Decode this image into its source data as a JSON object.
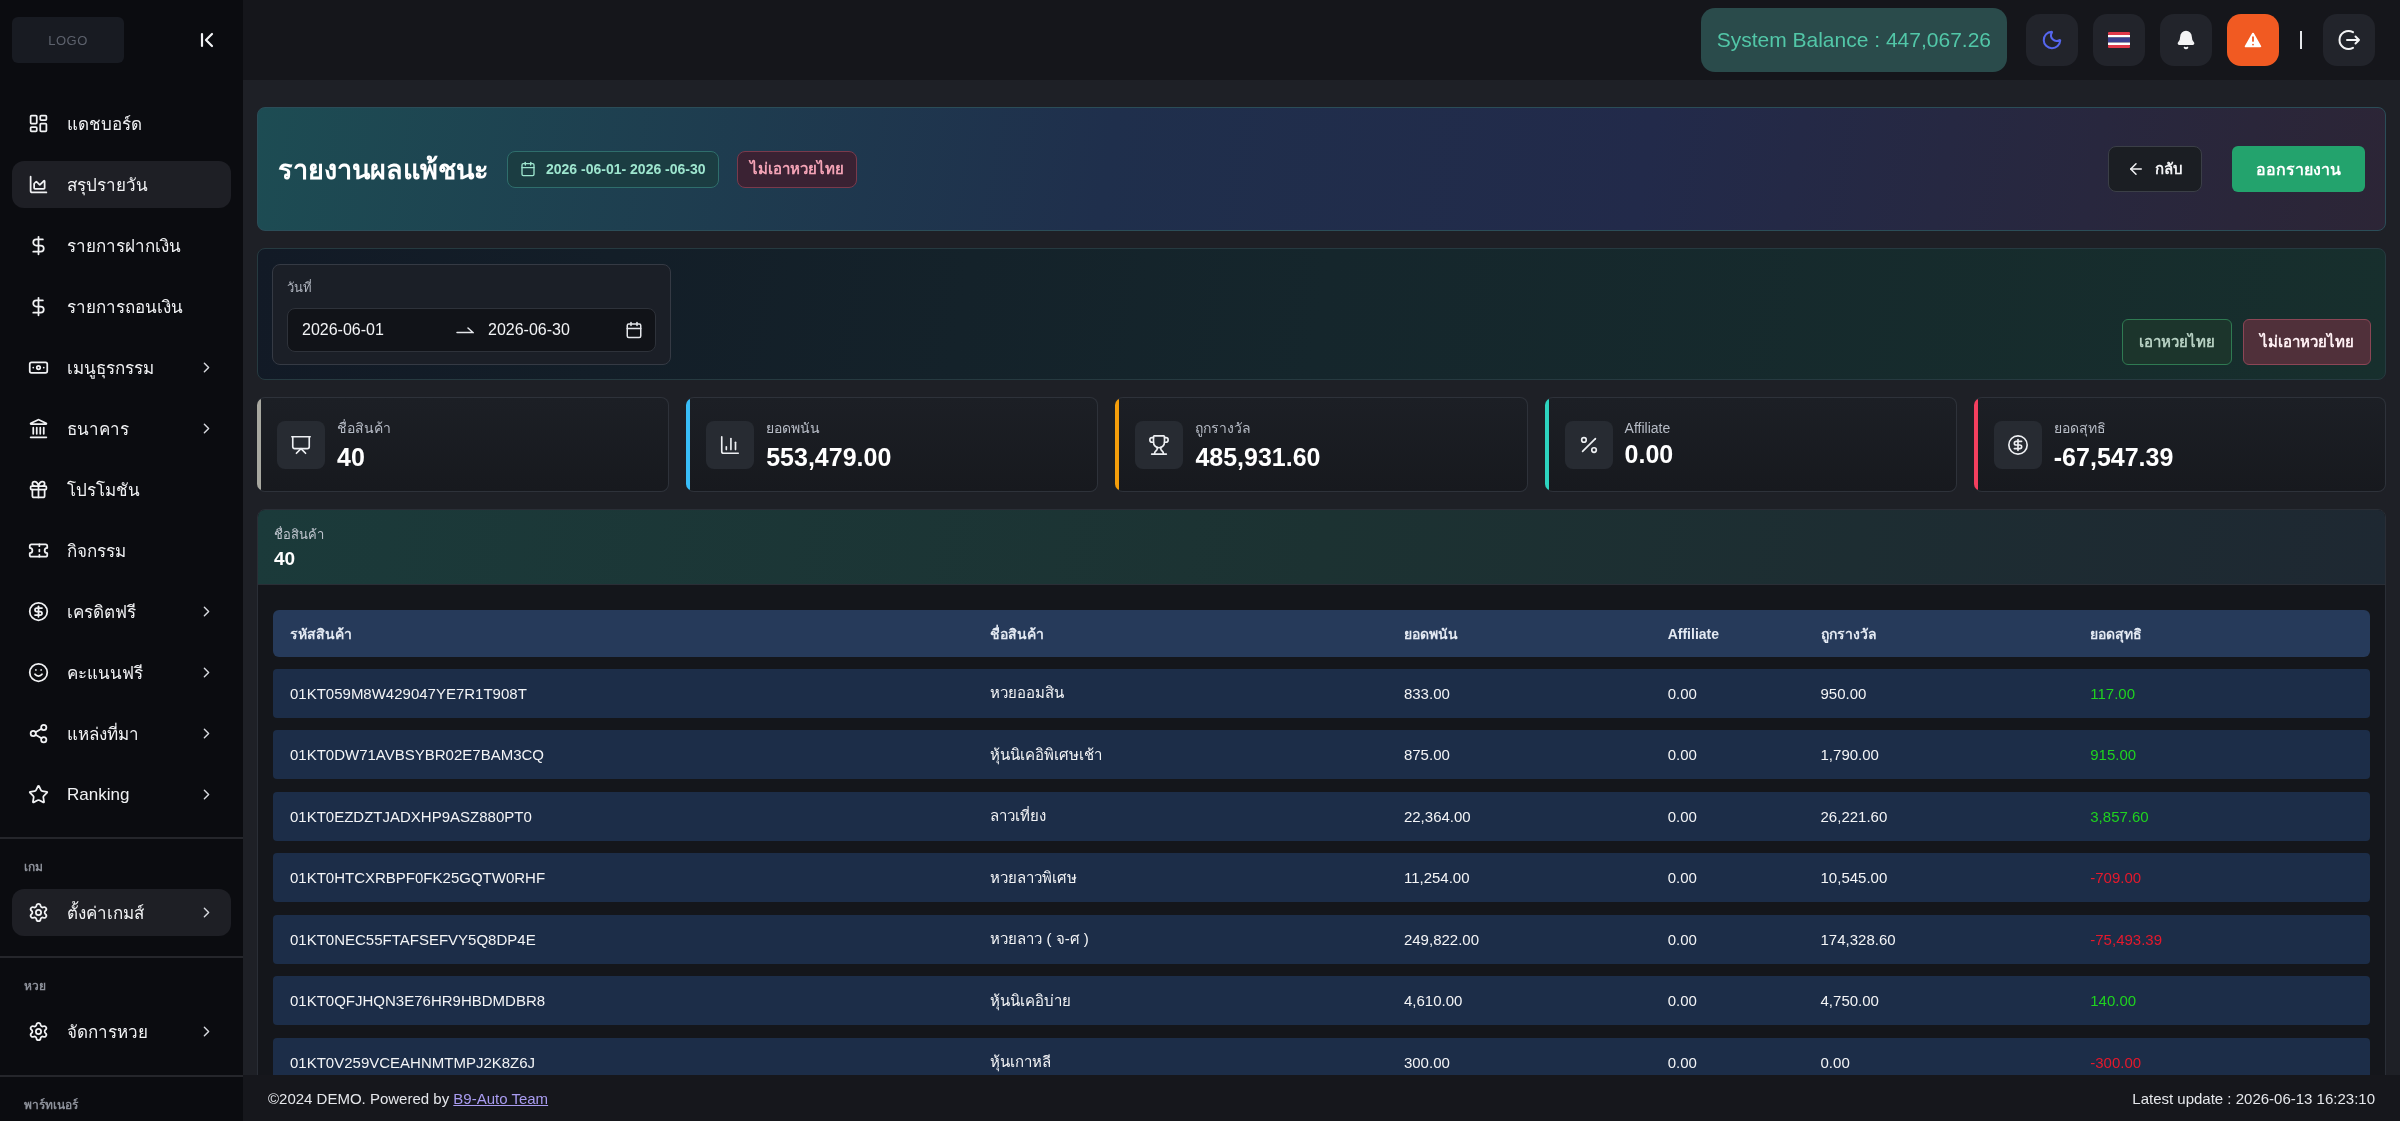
{
  "sidebar": {
    "logo": "LOGO",
    "items": [
      {
        "label": "แดชบอร์ด",
        "selected": false,
        "submenu": false
      },
      {
        "label": "สรุปรายวัน",
        "selected": true,
        "submenu": false
      },
      {
        "label": "รายการฝากเงิน",
        "selected": false,
        "submenu": false
      },
      {
        "label": "รายการถอนเงิน",
        "selected": false,
        "submenu": false
      },
      {
        "label": "เมนูธุรกรรม",
        "selected": false,
        "submenu": true
      },
      {
        "label": "ธนาคาร",
        "selected": false,
        "submenu": true
      },
      {
        "label": "โปรโมชัน",
        "selected": false,
        "submenu": false
      },
      {
        "label": "กิจกรรม",
        "selected": false,
        "submenu": false
      },
      {
        "label": "เครดิตฟรี",
        "selected": false,
        "submenu": true
      },
      {
        "label": "คะแนนฟรี",
        "selected": false,
        "submenu": true
      },
      {
        "label": "แหล่งที่มา",
        "selected": false,
        "submenu": true
      },
      {
        "label": "Ranking",
        "selected": false,
        "submenu": true
      }
    ],
    "sections": [
      {
        "title": "เกม",
        "items": [
          {
            "label": "ตั้งค่าเกมส์",
            "selected": true,
            "submenu": true
          }
        ]
      },
      {
        "title": "หวย",
        "items": [
          {
            "label": "จัดการหวย",
            "selected": false,
            "submenu": true
          }
        ]
      },
      {
        "title": "พาร์ทเนอร์"
      }
    ]
  },
  "topbar": {
    "balance": "System Balance : 447,067.26"
  },
  "header": {
    "title": "รายงานผลแพ้ชนะ",
    "date_tag": "2026 -06-01- 2026 -06-30",
    "filter_tag": "ไม่เอาหวยไทย",
    "back_button": "กลับ",
    "export_button": "ออกรายงาน"
  },
  "filter": {
    "date_label": "วันที่",
    "start_date": "2026-06-01",
    "end_date": "2026-06-30",
    "toggles": [
      {
        "label": "เอาหวยไทย",
        "selected": false,
        "color": "#2f7a52"
      },
      {
        "label": "ไม่เอาหวยไทย",
        "selected": true,
        "color": "#8c4656"
      }
    ]
  },
  "stats": [
    {
      "label": "ชื่อสินค้า",
      "value": "40",
      "color": "#a8a8a0"
    },
    {
      "label": "ยอดพนัน",
      "value": "553,479.00",
      "color": "#38bdf8"
    },
    {
      "label": "ถูกรางวัล",
      "value": "485,931.60",
      "color": "#f59e0b"
    },
    {
      "label": "Affiliate",
      "value": "0.00",
      "color": "#2dd4bf"
    },
    {
      "label": "ยอดสุทธิ",
      "value": "-67,547.39",
      "color": "#f43f5e"
    }
  ],
  "summary": {
    "label": "ชื่อสินค้า",
    "value": "40"
  },
  "table": {
    "columns": [
      "รหัสสินค้า",
      "ชื่อสินค้า",
      "ยอดพนัน",
      "Affiliate",
      "ถูกรางวัล",
      "ยอดสุทธิ"
    ],
    "rows": [
      {
        "code": "01KT059M8W429047YE7R1T908T",
        "name": "หวยออมสิน",
        "bet": "833.00",
        "affiliate": "0.00",
        "prize": "950.00",
        "net": "117.00",
        "color": "#1fd31f"
      },
      {
        "code": "01KT0DW71AVBSYBR02E7BAM3CQ",
        "name": "หุ้นนิเคอิพิเศษเช้า",
        "bet": "875.00",
        "affiliate": "0.00",
        "prize": "1,790.00",
        "net": "915.00",
        "color": "#1fd31f"
      },
      {
        "code": "01KT0EZDZTJADXHP9ASZ880PT0",
        "name": "ลาวเที่ยง",
        "bet": "22,364.00",
        "affiliate": "0.00",
        "prize": "26,221.60",
        "net": "3,857.60",
        "color": "#1fd31f"
      },
      {
        "code": "01KT0HTCXRBPF0FK25GQTW0RHF",
        "name": "หวยลาวพิเศษ",
        "bet": "11,254.00",
        "affiliate": "0.00",
        "prize": "10,545.00",
        "net": "-709.00",
        "color": "#e5192c"
      },
      {
        "code": "01KT0NEC55FTAFSEFVY5Q8DP4E",
        "name": "หวยลาว ( จ-ศ )",
        "bet": "249,822.00",
        "affiliate": "0.00",
        "prize": "174,328.60",
        "net": "-75,493.39",
        "color": "#e5192c"
      },
      {
        "code": "01KT0QFJHQN3E76HR9HBDMDBR8",
        "name": "หุ้นนิเคอิบ่าย",
        "bet": "4,610.00",
        "affiliate": "0.00",
        "prize": "4,750.00",
        "net": "140.00",
        "color": "#1fd31f"
      },
      {
        "code": "01KT0V259VCEAHNMTMPJ2K8Z6J",
        "name": "หุ้นเกาหลี",
        "bet": "300.00",
        "affiliate": "0.00",
        "prize": "0.00",
        "net": "-300.00",
        "color": "#e5192c"
      }
    ]
  },
  "footer": {
    "copyright": "©2024 DEMO. Powered by",
    "link": "B9-Auto Team",
    "last_update": "Latest update : 2026-06-13 16:23:10"
  }
}
